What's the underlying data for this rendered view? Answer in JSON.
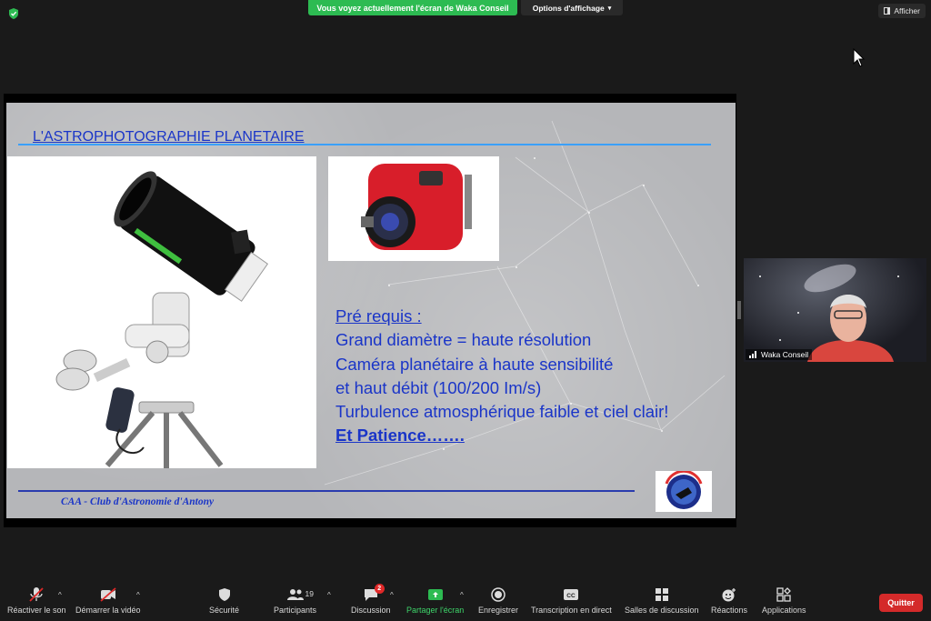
{
  "topbar": {
    "share_banner": "Vous voyez actuellement l'écran de Waka Conseil",
    "view_options": "Options d'affichage",
    "show_button": "Afficher"
  },
  "slide": {
    "title": "L'ASTROPHOTOGRAPHIE PLANETAIRE",
    "bullets": {
      "heading": "Pré requis :",
      "line1": "Grand diamètre  = haute résolution",
      "line2": "Caméra planétaire à haute sensibilité",
      "line3": "et haut débit (100/200 Im/s)",
      "line4": "Turbulence atmosphérique faible et ciel clair!",
      "line5": "Et Patience……."
    },
    "footer": "CAA - Club d'Astronomie d'Antony"
  },
  "participant": {
    "name": "Waka Conseil"
  },
  "toolbar": {
    "unmute": "Réactiver le son",
    "start_video": "Démarrer la vidéo",
    "security": "Sécurité",
    "participants": "Participants",
    "participants_count": "19",
    "chat": "Discussion",
    "chat_badge": "2",
    "share_screen": "Partager l'écran",
    "record": "Enregistrer",
    "transcription": "Transcription en direct",
    "breakout": "Salles de discussion",
    "reactions": "Réactions",
    "apps": "Applications",
    "quit": "Quitter"
  },
  "colors": {
    "accent_green": "#2dbb52",
    "danger_red": "#d42a2a",
    "slide_text_blue": "#1a35c8"
  }
}
